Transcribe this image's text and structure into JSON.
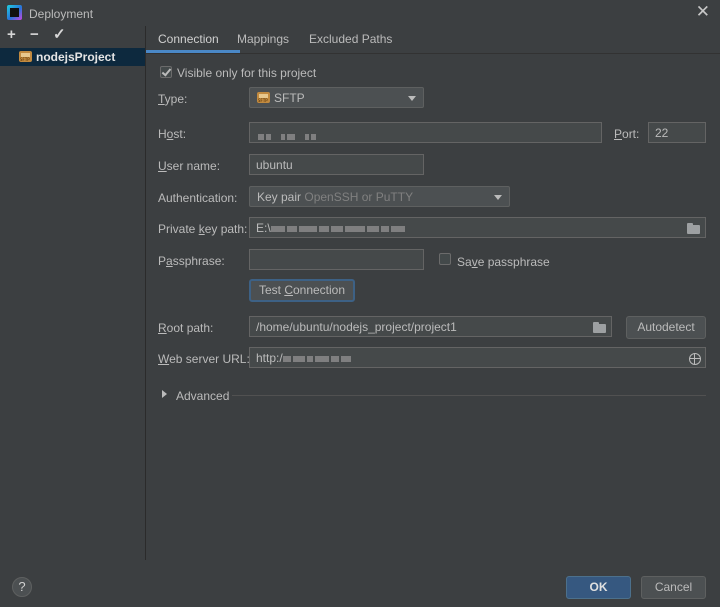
{
  "window": {
    "title": "Deployment",
    "close_glyph": "✕"
  },
  "left_toolbar": {
    "add": "+",
    "remove": "−",
    "apply": "✓"
  },
  "tree": {
    "items": [
      {
        "label": "nodejsProject",
        "icon": "sftp-icon"
      }
    ]
  },
  "tabs": [
    {
      "label": "Connection"
    },
    {
      "label": "Mappings"
    },
    {
      "label": "Excluded Paths"
    }
  ],
  "connection": {
    "visible_only": {
      "label": "Visible only for this project",
      "checked": true
    },
    "type": {
      "label": "Type:",
      "value": "SFTP"
    },
    "host": {
      "label": "Host:",
      "value": ""
    },
    "port": {
      "label": "Port:",
      "value": "22"
    },
    "user_name": {
      "label": "User name:",
      "value": "ubuntu"
    },
    "authentication": {
      "label": "Authentication:",
      "value": "Key pair",
      "hint": "OpenSSH or PuTTY"
    },
    "private_key_path": {
      "label": "Private key path:",
      "value_prefix": "E:\\"
    },
    "passphrase": {
      "label": "Passphrase:",
      "value": ""
    },
    "save_passphrase": {
      "label": "Save passphrase",
      "checked": false
    },
    "test_connection": {
      "label": "Test Connection"
    },
    "root_path": {
      "label": "Root path:",
      "value": "/home/ubuntu/nodejs_project/project1"
    },
    "autodetect": {
      "label": "Autodetect"
    },
    "web_server_url": {
      "label": "Web server URL:",
      "value_prefix": "http:/"
    },
    "advanced": {
      "label": "Advanced"
    }
  },
  "footer": {
    "help": "?",
    "ok": "OK",
    "cancel": "Cancel"
  },
  "colors": {
    "accent": "#4a88c7",
    "background": "#3c3f41",
    "selection": "#0d293e",
    "default_button": "#365880"
  }
}
